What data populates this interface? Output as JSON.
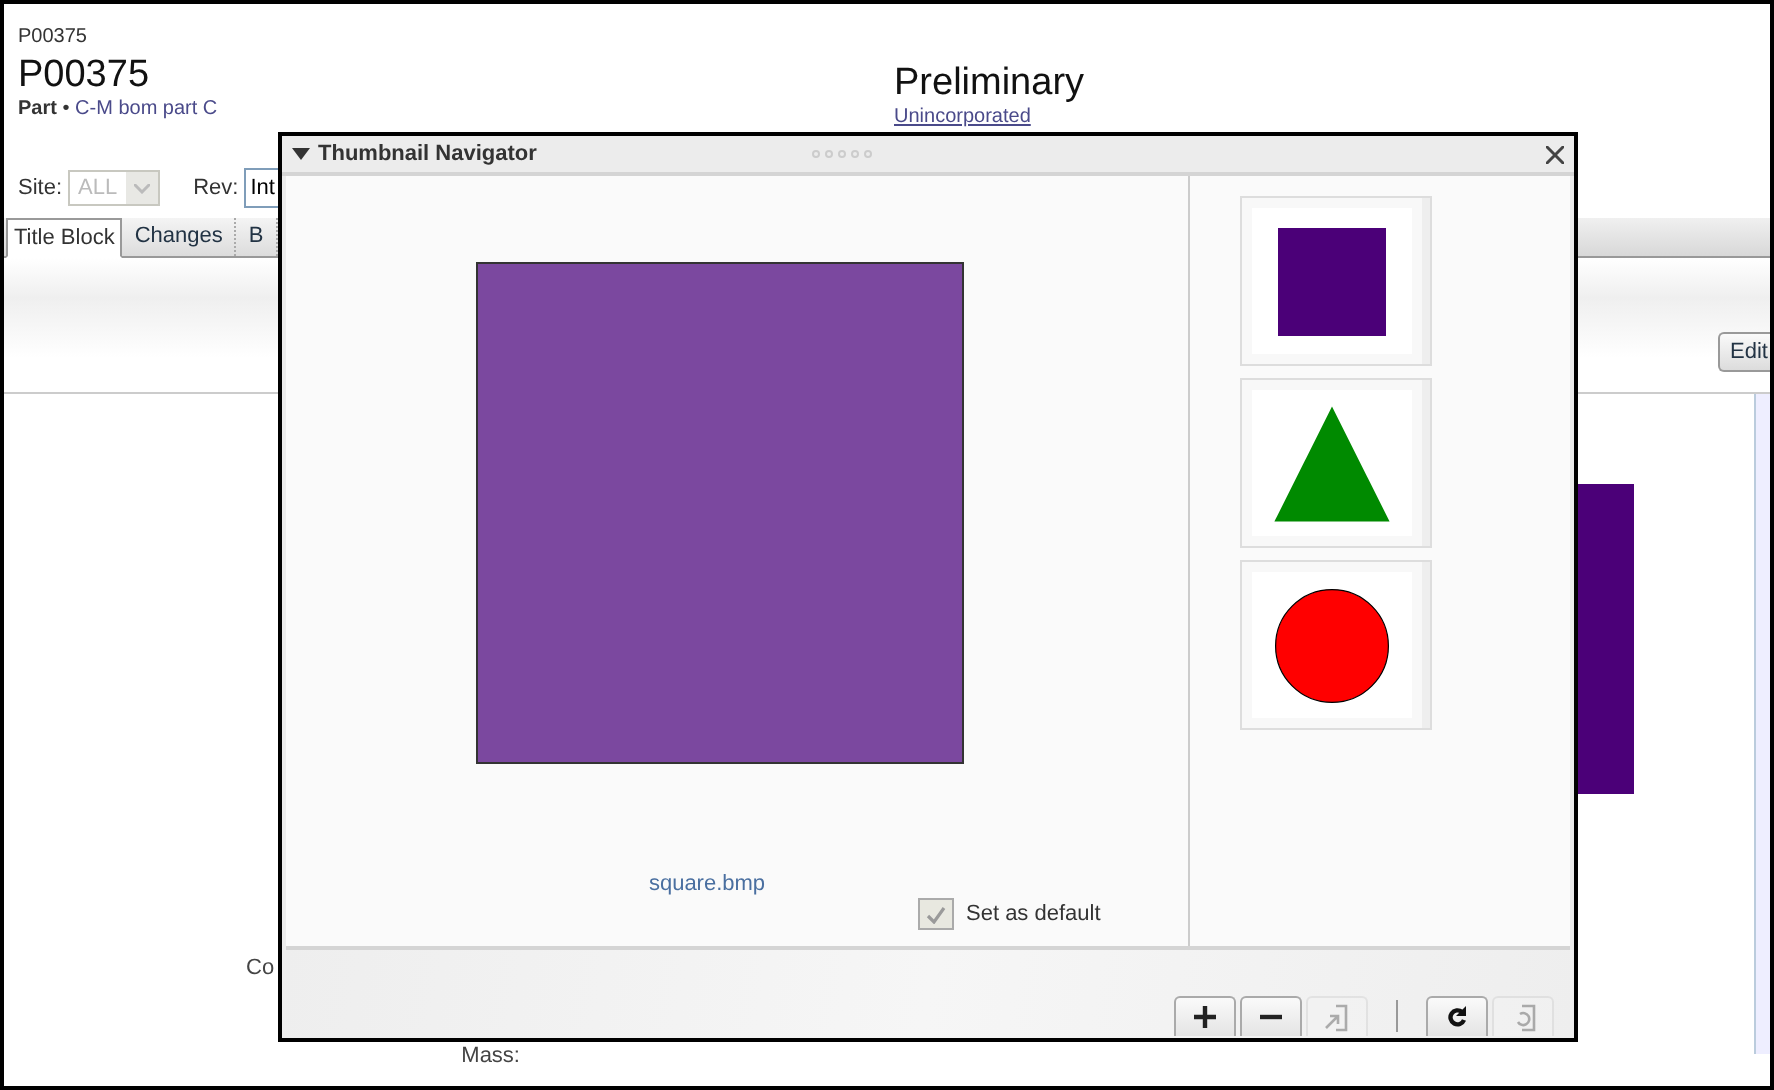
{
  "header": {
    "breadcrumb": "P00375",
    "number": "P00375",
    "type_label": "Part",
    "separator": "•",
    "part_name": "C-M bom part C",
    "status": "Preliminary",
    "substatus": "Unincorporated"
  },
  "filters": {
    "site": {
      "label": "Site:",
      "value": "ALL",
      "disabled": true
    },
    "rev": {
      "label": "Rev:",
      "value": "Int"
    }
  },
  "tabs": [
    {
      "label": "Title Block",
      "selected": true
    },
    {
      "label": "Changes",
      "selected": false
    },
    {
      "label": "B",
      "selected": false
    }
  ],
  "edit_button": "Edit",
  "fields": [
    {
      "label": "Co",
      "kind": "partial"
    },
    {
      "label": "Mass:",
      "kind": "full"
    }
  ],
  "dialog": {
    "title": "Thumbnail Navigator",
    "preview": {
      "kind": "square",
      "caption": "square.bmp"
    },
    "default_checkbox": {
      "label": "Set as default",
      "checked": true,
      "disabled": true
    },
    "thumbnails": [
      {
        "kind": "square",
        "selected": false
      },
      {
        "kind": "triangle",
        "selected": false
      },
      {
        "kind": "circle",
        "selected": false
      }
    ],
    "tools": [
      {
        "kind": "zoom-in",
        "disabled": false
      },
      {
        "kind": "zoom-out",
        "disabled": false
      },
      {
        "kind": "fit",
        "disabled": true
      },
      {
        "kind": "separator"
      },
      {
        "kind": "rotate",
        "disabled": false
      },
      {
        "kind": "rotate-back",
        "disabled": true
      }
    ]
  }
}
